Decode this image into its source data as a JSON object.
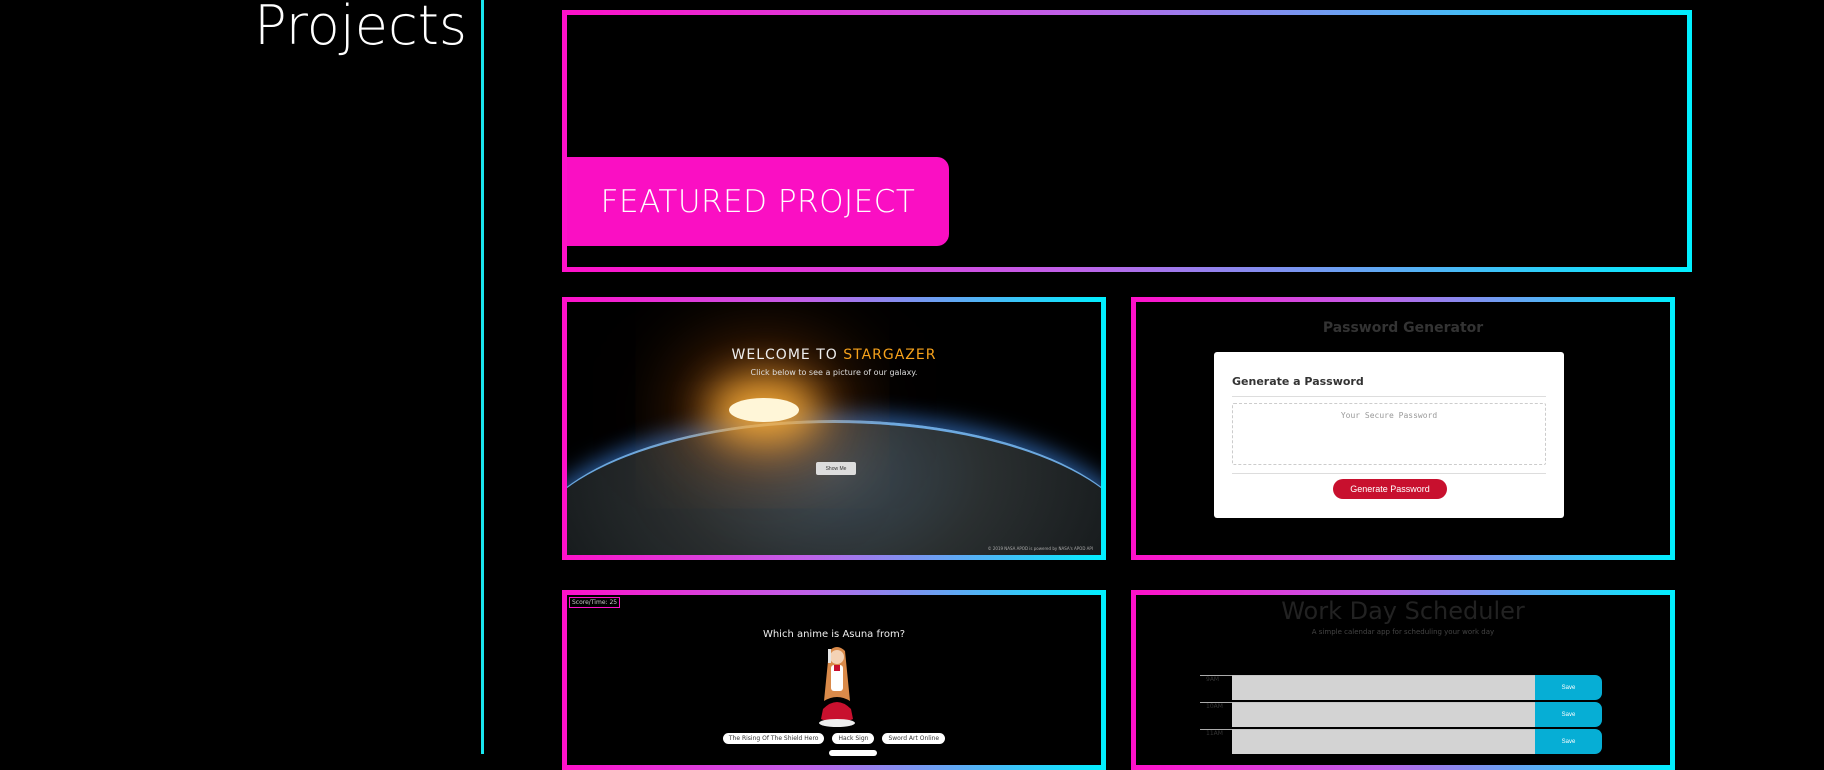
{
  "section": {
    "title": "Projects"
  },
  "featured": {
    "label": "FEATURED PROJECT"
  },
  "colors": {
    "pink": "#ff10c9",
    "cyan": "#00f0ff",
    "background": "#000000"
  },
  "projects": [
    {
      "name": "stargazer",
      "heading_prefix": "WELCOME TO ",
      "heading_brand": "STARGAZER",
      "subtitle": "Click below to see a picture of our galaxy.",
      "button": "Show Me",
      "footer": "© 2019 NASA APOD is powered by NASA's APOD API"
    },
    {
      "name": "password-generator",
      "title": "Password Generator",
      "card_heading": "Generate a Password",
      "placeholder": "Your Secure Password",
      "button": "Generate Password"
    },
    {
      "name": "anime-quiz",
      "score": "Score/Time: 25",
      "question": "Which anime is Asuna from?",
      "options": [
        "The Rising Of The Shield Hero",
        "Hack Sign",
        "Sword Art Online"
      ]
    },
    {
      "name": "work-day-scheduler",
      "title": "Work Day Scheduler",
      "subtitle": "A simple calendar app for scheduling your work day",
      "hours": [
        "9AM",
        "10AM",
        "11AM"
      ],
      "save": "Save"
    }
  ]
}
